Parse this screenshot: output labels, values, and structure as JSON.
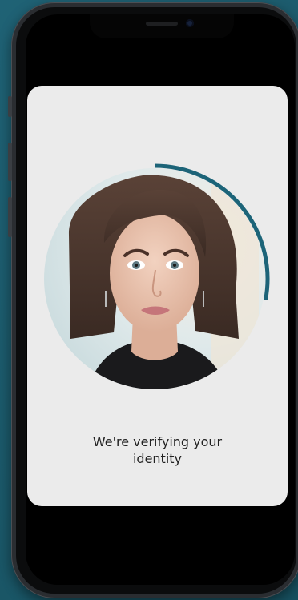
{
  "verification": {
    "status_text": "We're verifying your identity",
    "progress": 0.28
  },
  "colors": {
    "progress_ring": "#1c6478",
    "card_background": "#ebebeb",
    "page_background": "#1b5868"
  },
  "icons": [
    "front-camera-icon"
  ]
}
